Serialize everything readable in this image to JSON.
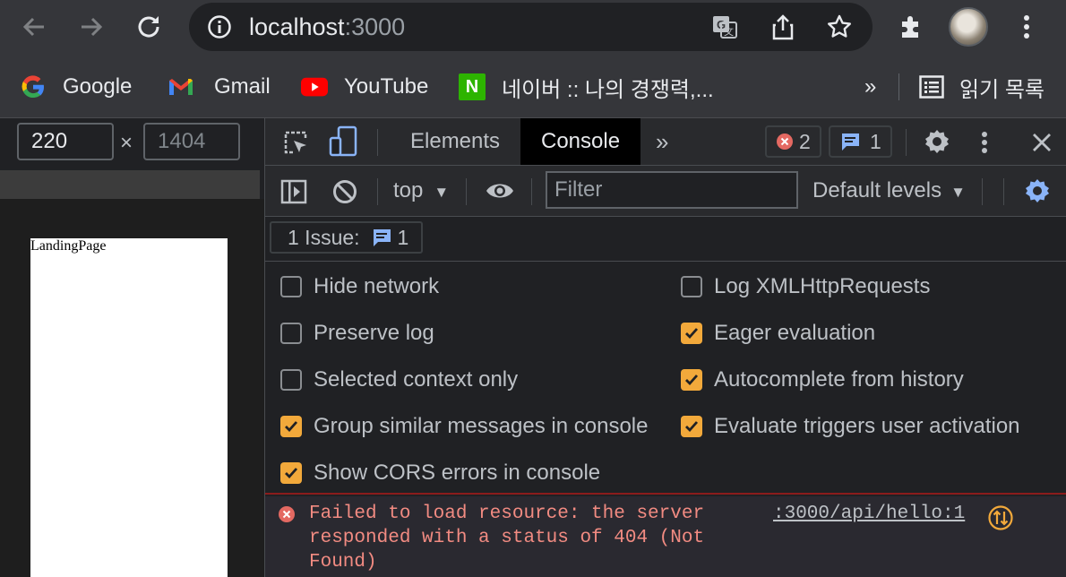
{
  "browser": {
    "url_host": "localhost",
    "url_port": ":3000"
  },
  "bookmarks": [
    {
      "label": "Google",
      "icon": "google-icon"
    },
    {
      "label": "Gmail",
      "icon": "gmail-icon"
    },
    {
      "label": "YouTube",
      "icon": "youtube-icon"
    },
    {
      "label": "네이버 :: 나의 경쟁력,...",
      "icon": "naver-icon",
      "icon_letter": "N"
    }
  ],
  "bookmarks_overflow": "»",
  "reading_list": "읽기 목록",
  "device": {
    "width": "220",
    "height": "1404",
    "separator": "×"
  },
  "page": {
    "text": "LandingPage"
  },
  "devtools": {
    "tabs": [
      "Elements",
      "Console"
    ],
    "active_tab": "Console",
    "more": "»",
    "error_count": "2",
    "issue_count": "1",
    "context": "top",
    "filter_placeholder": "Filter",
    "levels": "Default levels",
    "issues_label": "1 Issue:",
    "issues_count": "1"
  },
  "settings": {
    "left": [
      {
        "label": "Hide network",
        "checked": false
      },
      {
        "label": "Preserve log",
        "checked": false
      },
      {
        "label": "Selected context only",
        "checked": false
      },
      {
        "label": "Group similar messages in console",
        "checked": true
      },
      {
        "label": "Show CORS errors in console",
        "checked": true
      }
    ],
    "right": [
      {
        "label": "Log XMLHttpRequests",
        "checked": false
      },
      {
        "label": "Eager evaluation",
        "checked": true
      },
      {
        "label": "Autocomplete from history",
        "checked": true
      },
      {
        "label": "Evaluate triggers user activation",
        "checked": true
      }
    ]
  },
  "console": {
    "error_message": "Failed to load resource: the server responded with a status of 404 (Not Found)",
    "error_source": ":3000/api/hello:1"
  },
  "colors": {
    "checkbox_on": "#f2a93b",
    "error_text": "#f28b82",
    "error_icon": "#e46962",
    "accent_blue": "#8ab4f8"
  }
}
